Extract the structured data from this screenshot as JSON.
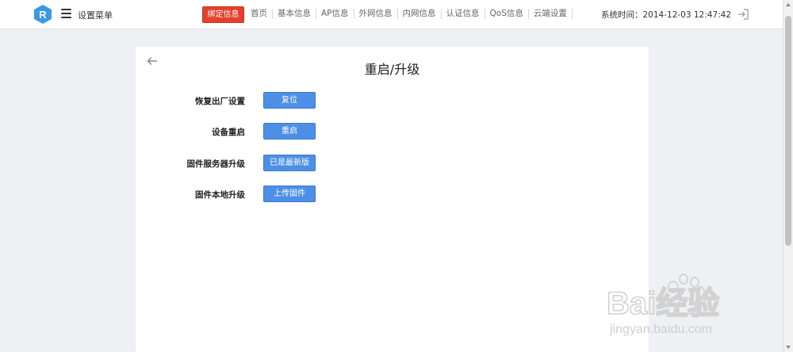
{
  "header": {
    "logo_letter": "R",
    "menu_title": "设置菜单",
    "bind_button": "绑定信息",
    "nav": [
      "首页",
      "基本信息",
      "AP信息",
      "外网信息",
      "内网信息",
      "认证信息",
      "QoS信息",
      "云端设置"
    ],
    "system_time_label": "系统时间：",
    "system_time_value": "2014-12-03 12:47:42",
    "icons": {
      "menu": "hamburger-icon",
      "logout": "logout-icon"
    }
  },
  "panel": {
    "title": "重启/升级",
    "back_icon": "arrow-left-icon",
    "rows": [
      {
        "label": "恢复出厂设置",
        "button": "复位"
      },
      {
        "label": "设备重启",
        "button": "重启"
      },
      {
        "label": "固件服务器升级",
        "button": "已是最新版"
      },
      {
        "label": "固件本地升级",
        "button": "上传固件"
      }
    ]
  },
  "watermark": {
    "brand": "Bai经验",
    "url": "jingyan.baidu.com"
  },
  "colors": {
    "accent_red": "#e4402b",
    "button_blue": "#4d8fe6",
    "logo_blue": "#3a98e8",
    "background": "#eef0f4"
  }
}
